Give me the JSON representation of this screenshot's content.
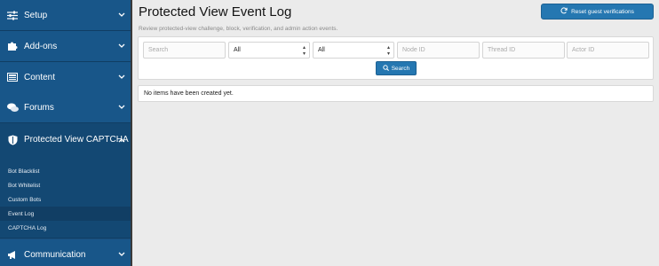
{
  "sidebar": {
    "sections": [
      {
        "label": "Setup",
        "icon": "sliders-icon"
      },
      {
        "label": "Add-ons",
        "icon": "puzzle-icon"
      },
      {
        "label": "Content",
        "icon": "content-icon"
      },
      {
        "label": "Forums",
        "icon": "forums-icon"
      },
      {
        "label": "Protected View CAPTCHA",
        "icon": "shield-icon"
      },
      {
        "label": "Communication",
        "icon": "megaphone-icon"
      }
    ],
    "sub_items": [
      "Bot Blacklist",
      "Bot Whitelist",
      "Custom Bots",
      "Event Log",
      "CAPTCHA Log"
    ]
  },
  "page": {
    "title": "Protected View Event Log",
    "subtitle": "Review protected-view challenge, block, verification, and admin action events.",
    "reset_button": "Reset guest verifications"
  },
  "filters": {
    "search_placeholder": "Search",
    "select1_value": "All",
    "select2_value": "All",
    "node_placeholder": "Node ID",
    "thread_placeholder": "Thread ID",
    "actor_placeholder": "Actor ID",
    "search_button": "Search"
  },
  "results": {
    "empty_message": "No items have been created yet."
  },
  "colors": {
    "sidebar_bg": "#185689",
    "accent": "#2577b1"
  }
}
